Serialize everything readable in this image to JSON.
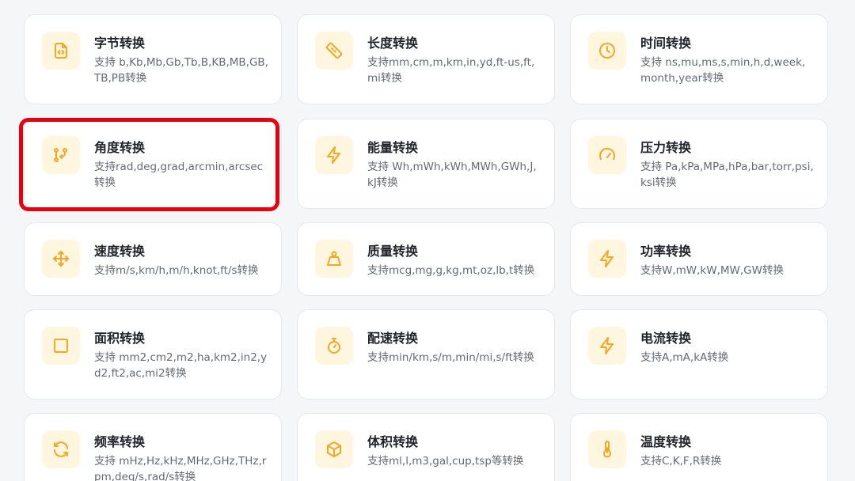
{
  "cards": [
    {
      "title": "字节转换",
      "desc": "支持 b,Kb,Mb,Gb,Tb,B,KB,MB,GB,TB,PB转换",
      "icon": "file-code-icon"
    },
    {
      "title": "长度转换",
      "desc": "支持mm,cm,m,km,in,yd,ft-us,ft,mi转换",
      "icon": "ruler-icon"
    },
    {
      "title": "时间转换",
      "desc": "支持 ns,mu,ms,s,min,h,d,week,month,year转换",
      "icon": "clock-icon"
    },
    {
      "title": "角度转换",
      "desc": "支持rad,deg,grad,arcmin,arcsec转换",
      "icon": "angle-icon"
    },
    {
      "title": "能量转换",
      "desc": "支持 Wh,mWh,kWh,MWh,GWh,J,kJ转换",
      "icon": "lightning-icon"
    },
    {
      "title": "压力转换",
      "desc": "支持 Pa,kPa,MPa,hPa,bar,torr,psi,ksi转换",
      "icon": "gauge-icon"
    },
    {
      "title": "速度转换",
      "desc": "支持m/s,km/h,m/h,knot,ft/s转换",
      "icon": "move-icon"
    },
    {
      "title": "质量转换",
      "desc": "支持mcg,mg,g,kg,mt,oz,lb,t转换",
      "icon": "weight-icon"
    },
    {
      "title": "功率转换",
      "desc": "支持W,mW,kW,MW,GW转换",
      "icon": "lightning-icon"
    },
    {
      "title": "面积转换",
      "desc": "支持 mm2,cm2,m2,ha,km2,in2,yd2,ft2,ac,mi2转换",
      "icon": "square-icon"
    },
    {
      "title": "配速转换",
      "desc": "支持min/km,s/m,min/mi,s/ft转换",
      "icon": "stopwatch-icon"
    },
    {
      "title": "电流转换",
      "desc": "支持A,mA,kA转换",
      "icon": "lightning-icon"
    },
    {
      "title": "频率转换",
      "desc": "支持 mHz,Hz,kHz,MHz,GHz,THz,rpm,deg/s,rad/s转换",
      "icon": "refresh-icon"
    },
    {
      "title": "体积转换",
      "desc": "支持ml,l,m3,gal,cup,tsp等转换",
      "icon": "cube-icon"
    },
    {
      "title": "温度转换",
      "desc": "支持C,K,F,R转换",
      "icon": "thermometer-icon"
    }
  ],
  "colors": {
    "accent": "#f5a623",
    "icon_bg": "#fff6df",
    "highlight": "#e60012"
  }
}
